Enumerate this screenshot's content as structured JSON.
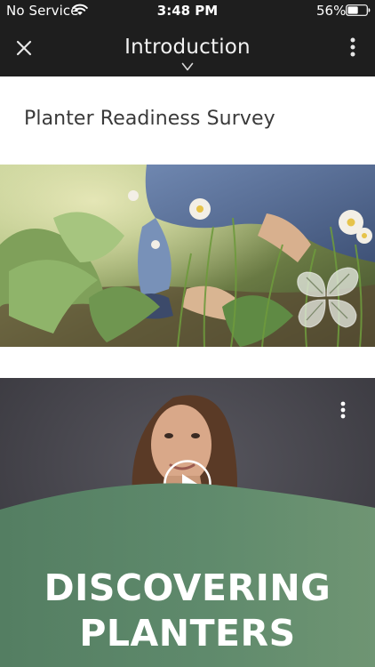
{
  "status_bar": {
    "carrier": "No Service",
    "time": "3:48 PM",
    "battery": "56%",
    "battery_level": 0.56,
    "icons": [
      "wifi-icon",
      "battery-icon"
    ]
  },
  "nav": {
    "title": "Introduction",
    "icons": [
      "close-icon",
      "chevron-down-icon",
      "more-vertical-icon"
    ]
  },
  "survey": {
    "title": "Planter Readiness Survey"
  },
  "hero": {
    "description_icons": [
      "leaf-logo-icon"
    ]
  },
  "video": {
    "headline_line1": "DISCOVERING",
    "headline_line2": "PLANTERS",
    "icons": [
      "more-vertical-icon",
      "play-icon"
    ]
  },
  "colors": {
    "bar_background": "#1e1e1e",
    "wave_green": "#5f8a6c",
    "video_background": "#403f46"
  }
}
